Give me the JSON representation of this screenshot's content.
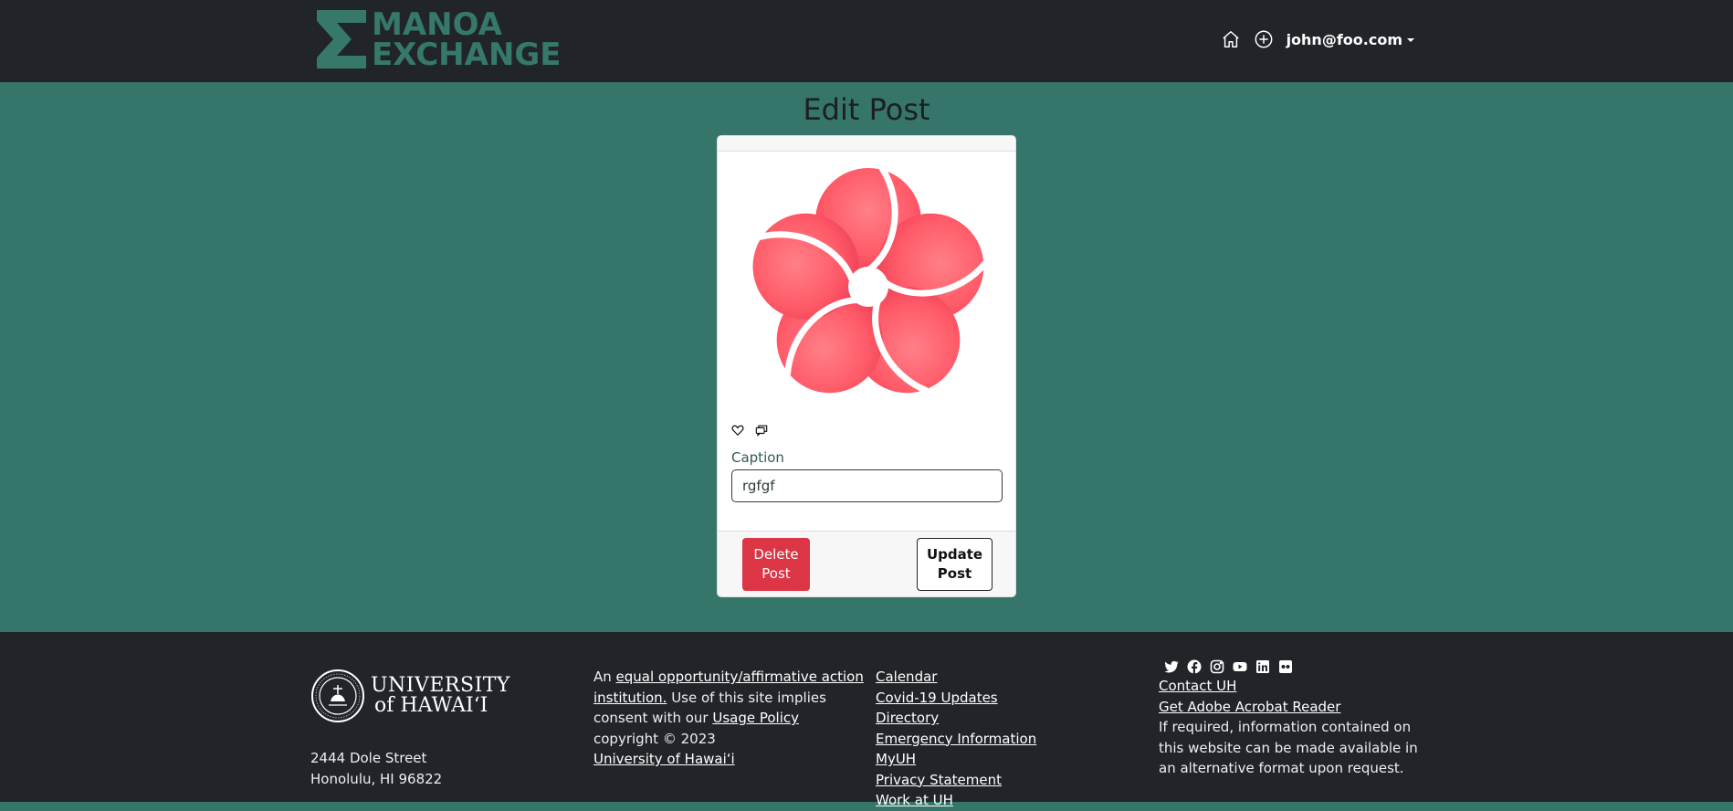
{
  "navbar": {
    "logo_line1": "MANOA",
    "logo_line2": "EXCHANGE",
    "home_icon": "home-icon",
    "add_icon": "plus-circle-icon",
    "user_email": "john@foo.com"
  },
  "main": {
    "page_title": "Edit Post",
    "post": {
      "image_icon": "flower-image",
      "like_icon": "heart-icon",
      "comments_icon": "comments-icon",
      "caption_label": "Caption",
      "caption_value": "rgfgf"
    },
    "delete_label": "Delete Post",
    "update_label": "Update Post"
  },
  "footer": {
    "uh_line1": "UNIVERSITY",
    "uh_line2": "of HAWAI‘I",
    "address_line1": "2444 Dole Street",
    "address_line2": "Honolulu, HI 96822",
    "statement_prefix": "An ",
    "eeo_link": "equal opportunity/affirmative action institution.",
    "statement_middle": " Use of this site implies consent with our ",
    "usage_policy_link": "Usage Policy",
    "copyright": "copyright © 2023",
    "uh_link": "University of Hawai‘i",
    "links": [
      "Calendar",
      "Covid-19 Updates",
      "Directory",
      "Emergency Information",
      "MyUH",
      "Privacy Statement",
      "Work at UH"
    ],
    "social_icons": [
      "twitter-icon",
      "facebook-icon",
      "instagram-icon",
      "youtube-icon",
      "linkedin-icon",
      "flickr-icon"
    ],
    "contact_link": "Contact UH",
    "acrobat_link": "Get Adobe Acrobat Reader",
    "accessibility_text": "If required, information contained on this website can be made available in an alternative format upon request."
  },
  "colors": {
    "navbar_bg": "#212529",
    "page_bg": "#367569",
    "logo": "#36786a",
    "delete": "#dc3545",
    "flower": "#ff5a68"
  }
}
